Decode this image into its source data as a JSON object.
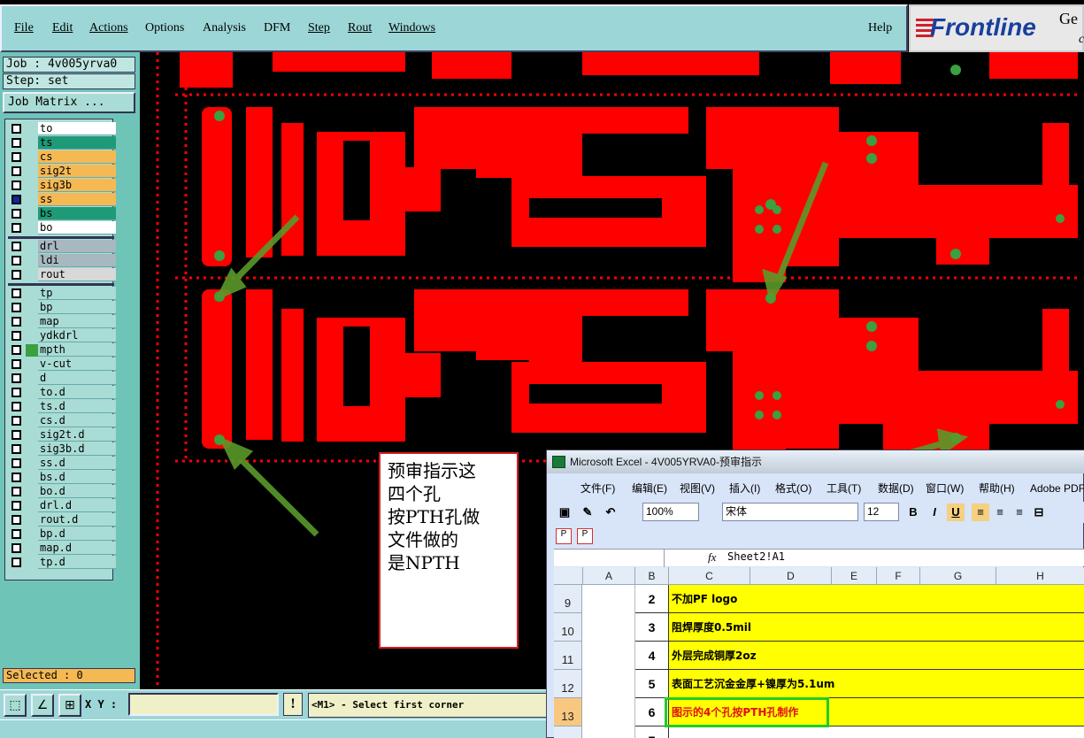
{
  "menubar": {
    "items": [
      "File",
      "Edit",
      "Actions",
      "Options",
      "Analysis",
      "DFM",
      "Step",
      "Rout",
      "Windows"
    ],
    "help": "Help"
  },
  "logo": {
    "brand": "Frontline",
    "suffix": "Ge",
    "suffix2": "c"
  },
  "job": {
    "label": "Job : 4v005yrva0",
    "step": "Step: set",
    "matrix_button": "Job Matrix ..."
  },
  "layers": [
    {
      "name": "to",
      "color": "#ffffff",
      "checked": false
    },
    {
      "name": "ts",
      "color": "#1e9a78",
      "checked": false
    },
    {
      "name": "cs",
      "color": "#f5b954",
      "checked": false
    },
    {
      "name": "sig2t",
      "color": "#f5b954",
      "checked": false
    },
    {
      "name": "sig3b",
      "color": "#f5b954",
      "checked": false
    },
    {
      "name": "ss",
      "color": "#f5b954",
      "checked": true
    },
    {
      "name": "bs",
      "color": "#1e9a78",
      "checked": false
    },
    {
      "name": "bo",
      "color": "#ffffff",
      "checked": false
    },
    {
      "name": "drl",
      "color": "#a8b8c0",
      "checked": false
    },
    {
      "name": "ldi",
      "color": "#a8b8c0",
      "checked": false
    },
    {
      "name": "rout",
      "color": "#d8d8d8",
      "checked": false
    },
    {
      "name": "tp",
      "color": "#a9dcd4",
      "checked": false
    },
    {
      "name": "bp",
      "color": "#a9dcd4",
      "checked": false
    },
    {
      "name": "map",
      "color": "#a9dcd4",
      "checked": false
    },
    {
      "name": "ydkdrl",
      "color": "#a9dcd4",
      "checked": false
    },
    {
      "name": "mpth",
      "color": "#a9dcd4",
      "checked": false,
      "swatch": "#3aa040"
    },
    {
      "name": "v-cut",
      "color": "#a9dcd4",
      "checked": false
    },
    {
      "name": "d",
      "color": "#a9dcd4",
      "checked": false
    },
    {
      "name": "to.d",
      "color": "#a9dcd4",
      "checked": false
    },
    {
      "name": "ts.d",
      "color": "#a9dcd4",
      "checked": false
    },
    {
      "name": "cs.d",
      "color": "#a9dcd4",
      "checked": false
    },
    {
      "name": "sig2t.d",
      "color": "#a9dcd4",
      "checked": false
    },
    {
      "name": "sig3b.d",
      "color": "#a9dcd4",
      "checked": false
    },
    {
      "name": "ss.d",
      "color": "#a9dcd4",
      "checked": false
    },
    {
      "name": "bs.d",
      "color": "#a9dcd4",
      "checked": false
    },
    {
      "name": "bo.d",
      "color": "#a9dcd4",
      "checked": false
    },
    {
      "name": "drl.d",
      "color": "#a9dcd4",
      "checked": false
    },
    {
      "name": "rout.d",
      "color": "#a9dcd4",
      "checked": false
    },
    {
      "name": "bp.d",
      "color": "#a9dcd4",
      "checked": false
    },
    {
      "name": "map.d",
      "color": "#a9dcd4",
      "checked": false
    },
    {
      "name": "tp.d",
      "color": "#a9dcd4",
      "checked": false
    }
  ],
  "selected": "Selected : 0",
  "bottom": {
    "xy_label": "X Y :",
    "xy_value": "",
    "warn": "!",
    "status": "<M1> - Select first corner"
  },
  "note": {
    "lines": [
      "预审指示这",
      "四个孔",
      "按PTH孔做",
      "文件做的",
      "是NPTH"
    ]
  },
  "excel": {
    "title": "Microsoft Excel - 4V005YRVA0-预审指示",
    "menu": [
      "文件(F)",
      "编辑(E)",
      "视图(V)",
      "插入(I)",
      "格式(O)",
      "工具(T)",
      "数据(D)",
      "窗口(W)",
      "帮助(H)",
      "Adobe PDF"
    ],
    "zoom": "100%",
    "font": "宋体",
    "size": "12",
    "name_box": "",
    "formula": "Sheet2!A1",
    "columns": [
      "A",
      "B",
      "C",
      "D",
      "E",
      "F",
      "G",
      "H"
    ],
    "rows": [
      {
        "num": "9",
        "b": "2",
        "c": "不加PF logo",
        "red": false
      },
      {
        "num": "10",
        "b": "3",
        "c": "阻焊厚度0.5mil",
        "red": false
      },
      {
        "num": "11",
        "b": "4",
        "c": "外层完成铜厚2oz",
        "red": false
      },
      {
        "num": "12",
        "b": "5",
        "c": "表面工艺沉金金厚+镍厚为5.1um",
        "red": false
      },
      {
        "num": "13",
        "b": "6",
        "c": "图示的4个孔按PTH孔制作",
        "red": true
      },
      {
        "num": "",
        "b": "7",
        "c": "",
        "red": false
      }
    ]
  },
  "colors": {
    "copper": "#ff0000",
    "pad": "#3aa040",
    "panel": "#9dd6d6",
    "arrow": "#5a9a2a"
  }
}
